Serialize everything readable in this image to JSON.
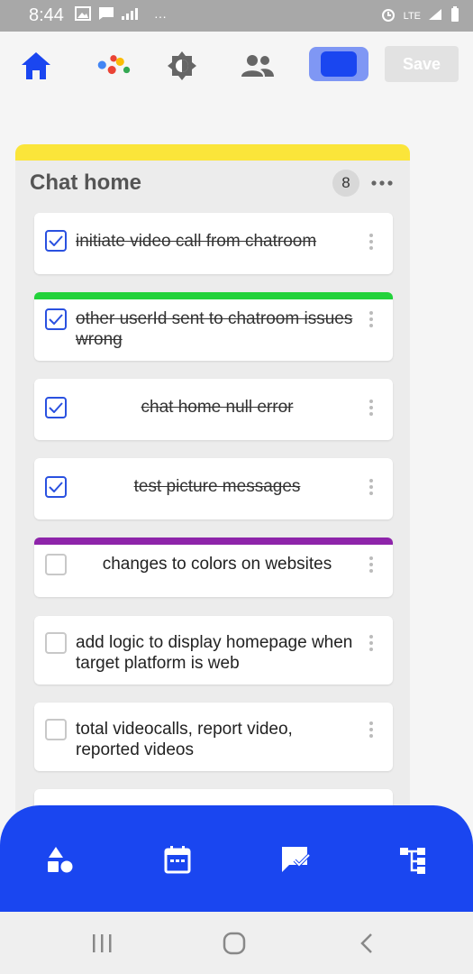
{
  "status_bar": {
    "time": "8:44",
    "ellipsis": "···",
    "network": "LTE"
  },
  "toolbar": {
    "save_label": "Save",
    "toggle_on": true
  },
  "column": {
    "title": "Chat home",
    "count": "8",
    "accent_color": "#fbe53a"
  },
  "cards": [
    {
      "text": "initiate video call from chatroom",
      "done": true
    },
    {
      "text": "other userId sent to chatroom issues wrong",
      "done": true,
      "label_color": "#22d23a"
    },
    {
      "text": "chat home null error",
      "done": true
    },
    {
      "text": "test picture messages",
      "done": true
    },
    {
      "text": "changes to colors on websites",
      "done": false,
      "label_color": "#8e24aa"
    },
    {
      "text": "add logic to display homepage when target platform is web",
      "done": false
    },
    {
      "text": "total videocalls, report video, reported videos",
      "done": false
    }
  ],
  "colors": {
    "accent": "#1a46f0",
    "check": "#2a51e0"
  },
  "bottom_nav": [
    "shapes-icon",
    "calendar-icon",
    "chat-check-icon",
    "hierarchy-icon"
  ],
  "system_nav": [
    "recents-icon",
    "home-circle-icon",
    "back-icon"
  ]
}
